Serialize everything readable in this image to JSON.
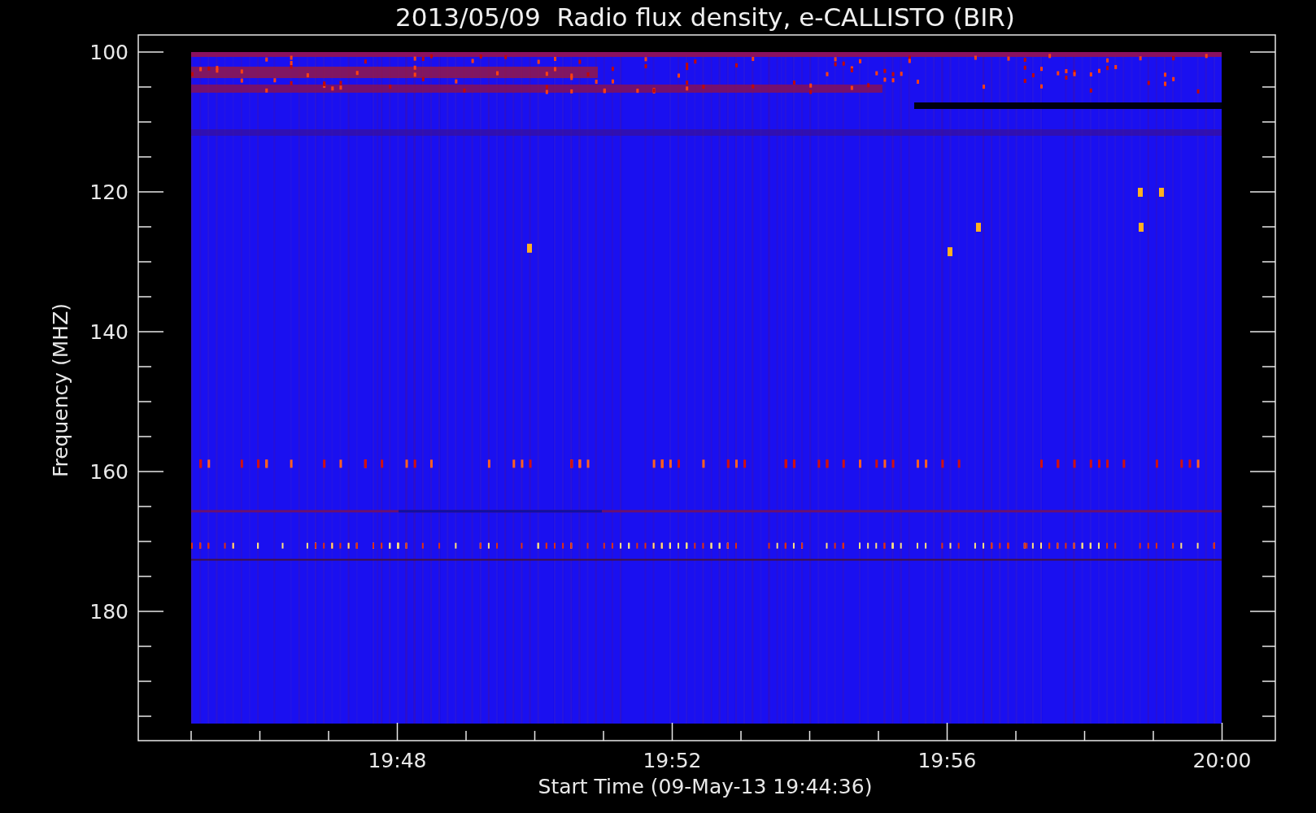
{
  "plot": {
    "title": "2013/05/09  Radio flux density, e-CALLISTO (BIR)",
    "ylabel": "Frequency (MHZ)",
    "xlabel": "Start Time (09-May-13 19:44:36)",
    "yticks": [
      "100",
      "120",
      "140",
      "160",
      "180"
    ],
    "xticks": [
      "19:48",
      "19:52",
      "19:56",
      "20:00"
    ]
  }
}
